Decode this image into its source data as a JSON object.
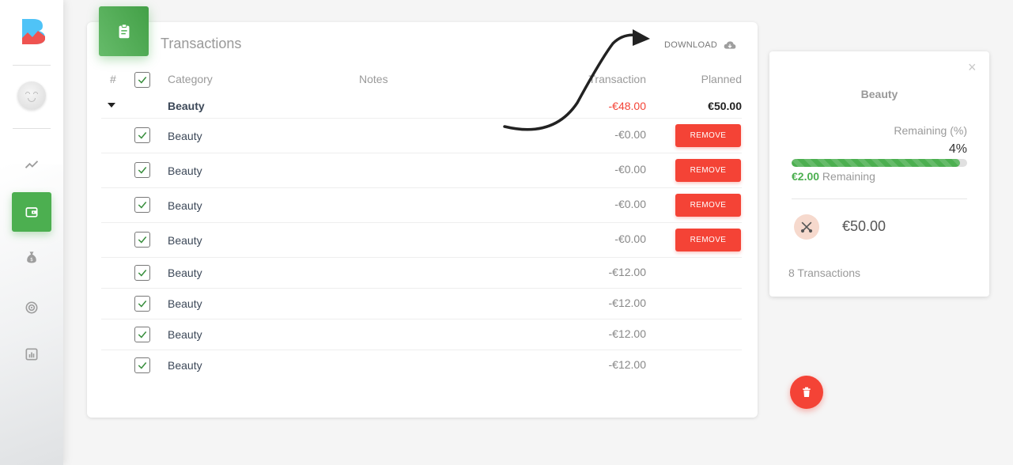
{
  "nav": {
    "items": [
      {
        "name": "trends",
        "icon": "trending-up-icon"
      },
      {
        "name": "wallet",
        "icon": "wallet-icon",
        "active": true
      },
      {
        "name": "savings",
        "icon": "money-bag-icon"
      },
      {
        "name": "goals",
        "icon": "target-icon"
      },
      {
        "name": "reports",
        "icon": "bar-chart-icon"
      }
    ]
  },
  "card": {
    "title": "Transactions",
    "download_label": "DOWNLOAD",
    "columns": {
      "index": "#",
      "category": "Category",
      "notes": "Notes",
      "transaction": "Transaction",
      "planned": "Planned"
    },
    "group": {
      "category": "Beauty",
      "transaction": "-€48.00",
      "planned": "€50.00"
    },
    "rows": [
      {
        "category": "Beauty",
        "amount": "-€0.00",
        "checked": true,
        "removable": true
      },
      {
        "category": "Beauty",
        "amount": "-€0.00",
        "checked": true,
        "removable": true
      },
      {
        "category": "Beauty",
        "amount": "-€0.00",
        "checked": true,
        "removable": true
      },
      {
        "category": "Beauty",
        "amount": "-€0.00",
        "checked": true,
        "removable": true
      },
      {
        "category": "Beauty",
        "amount": "-€12.00",
        "checked": true,
        "removable": false
      },
      {
        "category": "Beauty",
        "amount": "-€12.00",
        "checked": true,
        "removable": false
      },
      {
        "category": "Beauty",
        "amount": "-€12.00",
        "checked": true,
        "removable": false
      },
      {
        "category": "Beauty",
        "amount": "-€12.00",
        "checked": true,
        "removable": false
      }
    ],
    "remove_label": "REMOVE"
  },
  "panel": {
    "close": "×",
    "title": "Beauty",
    "remaining_label": "Remaining (%)",
    "remaining_percent": "4%",
    "progress_fraction": 0.96,
    "remaining_amount": "€2.00",
    "remaining_suffix": " Remaining",
    "planned": "€50.00",
    "transactions_count": "8 Transactions"
  },
  "colors": {
    "accent": "#4caf50",
    "danger": "#f44336",
    "expense": "#f44336"
  }
}
